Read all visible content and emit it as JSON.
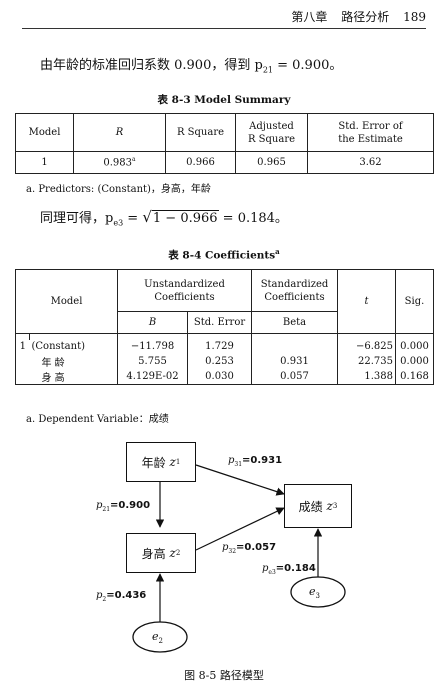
{
  "header": {
    "chapter": "第八章",
    "section": "路径分析",
    "page": "189"
  },
  "intro": {
    "text": "由年龄的标准回归系数 0.900，得到 p",
    "sub": "21",
    "tail": " = 0.900。"
  },
  "table1": {
    "caption": "表 8-3   Model Summary",
    "headers": [
      "Model",
      "R",
      "R Square",
      "Adjusted",
      "R Square",
      "Std. Error of",
      "the Estimate"
    ],
    "row": [
      "1",
      "0.983",
      "a",
      "0.966",
      "0.965",
      "3.62"
    ],
    "note": "a. Predictors: (Constant)，身高，年龄"
  },
  "formula": {
    "prefix": "同理可得，p",
    "sub": "e3",
    "mid": " = ",
    "radicand": "1 − 0.966",
    "tail": " = 0.184。"
  },
  "table2": {
    "caption": "表 8-4   Coefficients",
    "caption_sup": "a",
    "headers": {
      "model": "Model",
      "unstd1": "Unstandardized",
      "unstd2": "Coefficients",
      "std1": "Standardized",
      "std2": "Coefficients",
      "t": "t",
      "sig": "Sig.",
      "b": "B",
      "stderr": "Std. Error",
      "beta": "Beta"
    },
    "rows": [
      {
        "num": "1",
        "name": "(Constant)",
        "b": "−11.798",
        "se": "1.729",
        "beta": "",
        "t": "−6.825",
        "sig": "0.000"
      },
      {
        "num": "",
        "name": "年    龄",
        "b": "5.755",
        "se": "0.253",
        "beta": "0.931",
        "t": "22.735",
        "sig": "0.000"
      },
      {
        "num": "",
        "name": "身    高",
        "b": "4.129E-02",
        "se": "0.030",
        "beta": "0.057",
        "t": "1.388",
        "sig": "0.168"
      }
    ],
    "note": "a. Dependent Variable：成绩"
  },
  "diagram": {
    "nodes": {
      "age": {
        "label": "年龄",
        "var": "z",
        "sub": "1"
      },
      "height": {
        "label": "身高",
        "var": "z",
        "sub": "2"
      },
      "score": {
        "label": "成绩",
        "var": "z",
        "sub": "3"
      },
      "e2": {
        "var": "e",
        "sub": "2"
      },
      "e3": {
        "var": "e",
        "sub": "3"
      }
    },
    "paths": {
      "p31": {
        "p": "p",
        "sub": "31",
        "value": "=0.931"
      },
      "p21": {
        "p": "p",
        "sub": "21",
        "value": "=0.900"
      },
      "p32": {
        "p": "p",
        "sub": "32",
        "value": "=0.057"
      },
      "pe3": {
        "p": "p",
        "sub": "e3",
        "value": "=0.184"
      },
      "p2": {
        "p": "p",
        "sub": "2",
        "value": "=0.436"
      }
    },
    "caption": "图 8-5   路径模型"
  }
}
